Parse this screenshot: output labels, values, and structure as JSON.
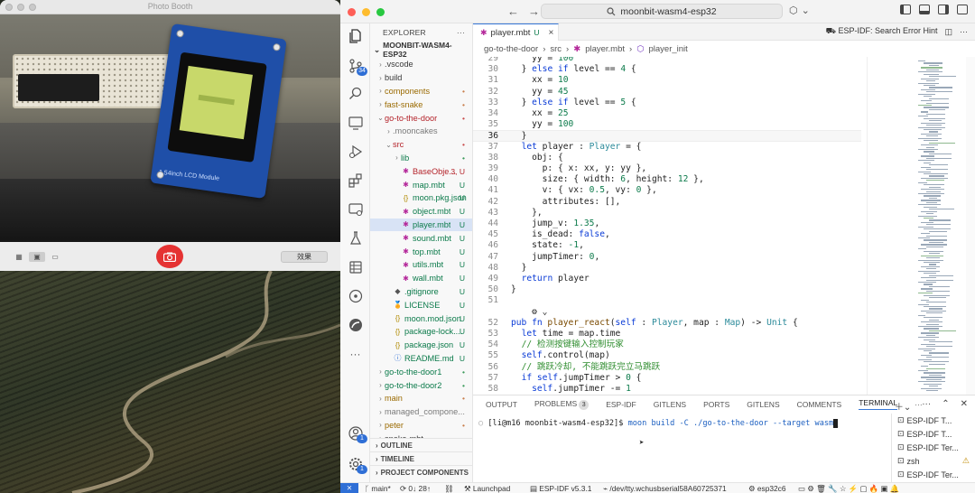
{
  "photobooth": {
    "title": "Photo Booth",
    "lcd_label": "1.54inch LCD Module",
    "effects_label": "效果"
  },
  "vscode": {
    "search_text": "moonbit-wasm4-esp32",
    "explorer_title": "EXPLORER",
    "root_folder": "MOONBIT-WASM4-ESP32",
    "tree": [
      {
        "name": ".vscode",
        "indent": 1,
        "chev": ">",
        "icon": "",
        "status": "",
        "color": "#3a3a3a"
      },
      {
        "name": "build",
        "indent": 1,
        "chev": ">",
        "icon": "",
        "status": "",
        "color": "#3a3a3a"
      },
      {
        "name": "components",
        "indent": 1,
        "chev": ">",
        "icon": "",
        "status": "•",
        "color": "#9a6a00",
        "scolor": "#c87d4b"
      },
      {
        "name": "fast-snake",
        "indent": 1,
        "chev": ">",
        "icon": "",
        "status": "•",
        "color": "#9a6a00",
        "scolor": "#c87d4b"
      },
      {
        "name": "go-to-the-door",
        "indent": 1,
        "chev": "⌄",
        "icon": "",
        "status": "•",
        "color": "#b4232a",
        "scolor": "#c84a4a"
      },
      {
        "name": ".mooncakes",
        "indent": 2,
        "chev": ">",
        "icon": "",
        "status": "",
        "color": "#7a7a7a"
      },
      {
        "name": "src",
        "indent": 2,
        "chev": "⌄",
        "icon": "",
        "status": "•",
        "color": "#b4232a",
        "scolor": "#c84a4a"
      },
      {
        "name": "lib",
        "indent": 3,
        "chev": ">",
        "icon": "",
        "status": "•",
        "color": "#0b7a4a",
        "scolor": "#3a9a5a"
      },
      {
        "name": "BaseObje...",
        "indent": 3,
        "chev": "",
        "icon": "✱",
        "status": "3, U",
        "color": "#b4232a",
        "scolor": "#b4232a",
        "icolor": "#b4289a"
      },
      {
        "name": "map.mbt",
        "indent": 3,
        "chev": "",
        "icon": "✱",
        "status": "U",
        "color": "#0b7a4a",
        "scolor": "#0b7a4a",
        "icolor": "#b4289a"
      },
      {
        "name": "moon.pkg.json",
        "indent": 3,
        "chev": "",
        "icon": "{}",
        "status": "U",
        "color": "#0b7a4a",
        "scolor": "#0b7a4a",
        "icolor": "#b08a00"
      },
      {
        "name": "object.mbt",
        "indent": 3,
        "chev": "",
        "icon": "✱",
        "status": "U",
        "color": "#0b7a4a",
        "scolor": "#0b7a4a",
        "icolor": "#b4289a"
      },
      {
        "name": "player.mbt",
        "indent": 3,
        "chev": "",
        "icon": "✱",
        "status": "U",
        "color": "#0b7a4a",
        "scolor": "#0b7a4a",
        "icolor": "#b4289a",
        "selected": true
      },
      {
        "name": "sound.mbt",
        "indent": 3,
        "chev": "",
        "icon": "✱",
        "status": "U",
        "color": "#0b7a4a",
        "scolor": "#0b7a4a",
        "icolor": "#b4289a"
      },
      {
        "name": "top.mbt",
        "indent": 3,
        "chev": "",
        "icon": "✱",
        "status": "U",
        "color": "#0b7a4a",
        "scolor": "#0b7a4a",
        "icolor": "#b4289a"
      },
      {
        "name": "utils.mbt",
        "indent": 3,
        "chev": "",
        "icon": "✱",
        "status": "U",
        "color": "#0b7a4a",
        "scolor": "#0b7a4a",
        "icolor": "#b4289a"
      },
      {
        "name": "wall.mbt",
        "indent": 3,
        "chev": "",
        "icon": "✱",
        "status": "U",
        "color": "#0b7a4a",
        "scolor": "#0b7a4a",
        "icolor": "#b4289a"
      },
      {
        "name": ".gitignore",
        "indent": 2,
        "chev": "",
        "icon": "◆",
        "status": "U",
        "color": "#0b7a4a",
        "scolor": "#0b7a4a",
        "icolor": "#555"
      },
      {
        "name": "LICENSE",
        "indent": 2,
        "chev": "",
        "icon": "🏅",
        "status": "U",
        "color": "#0b7a4a",
        "scolor": "#0b7a4a",
        "icolor": "#b08a00"
      },
      {
        "name": "moon.mod.json",
        "indent": 2,
        "chev": "",
        "icon": "{}",
        "status": "U",
        "color": "#0b7a4a",
        "scolor": "#0b7a4a",
        "icolor": "#b08a00"
      },
      {
        "name": "package-lock....",
        "indent": 2,
        "chev": "",
        "icon": "{}",
        "status": "U",
        "color": "#0b7a4a",
        "scolor": "#0b7a4a",
        "icolor": "#b08a00"
      },
      {
        "name": "package.json",
        "indent": 2,
        "chev": "",
        "icon": "{}",
        "status": "U",
        "color": "#0b7a4a",
        "scolor": "#0b7a4a",
        "icolor": "#b08a00"
      },
      {
        "name": "README.md",
        "indent": 2,
        "chev": "",
        "icon": "ⓘ",
        "status": "U",
        "color": "#0b7a4a",
        "scolor": "#0b7a4a",
        "icolor": "#2f6fd6"
      },
      {
        "name": "go-to-the-door1",
        "indent": 1,
        "chev": ">",
        "icon": "",
        "status": "•",
        "color": "#0b7a4a",
        "scolor": "#3a9a5a"
      },
      {
        "name": "go-to-the-door2",
        "indent": 1,
        "chev": ">",
        "icon": "",
        "status": "•",
        "color": "#0b7a4a",
        "scolor": "#3a9a5a"
      },
      {
        "name": "main",
        "indent": 1,
        "chev": ">",
        "icon": "",
        "status": "•",
        "color": "#9a6a00",
        "scolor": "#c87d4b"
      },
      {
        "name": "managed_compone...",
        "indent": 1,
        "chev": ">",
        "icon": "",
        "status": "",
        "color": "#7a7a7a"
      },
      {
        "name": "peter",
        "indent": 1,
        "chev": ">",
        "icon": "",
        "status": "•",
        "color": "#9a6a00",
        "scolor": "#c87d4b"
      },
      {
        "name": "snake-mbt",
        "indent": 1,
        "chev": ">",
        "icon": "",
        "status": "",
        "color": "#3a3a3a"
      }
    ],
    "sections": [
      "OUTLINE",
      "TIMELINE",
      "PROJECT COMPONENTS"
    ],
    "activity_badges": {
      "scm": "34",
      "accounts": "1",
      "manage": "1"
    },
    "tab_title": "player.mbt",
    "tab_status": "U",
    "tab_right_label": "ESP-IDF: Search Error Hint",
    "breadcrumbs": [
      "go-to-the-door",
      "src",
      "player.mbt",
      "player_init"
    ],
    "code_lines": [
      {
        "n": "29",
        "html": "    <span class=p>yy = </span><span class=n>100</span>"
      },
      {
        "n": "30",
        "html": "  <span class=p>} </span><span class=k>else if</span><span class=p> level == </span><span class=n>4</span><span class=p> {</span>"
      },
      {
        "n": "31",
        "html": "    <span class=p>xx = </span><span class=n>10</span>"
      },
      {
        "n": "32",
        "html": "    <span class=p>yy = </span><span class=n>45</span>"
      },
      {
        "n": "33",
        "html": "  <span class=p>} </span><span class=k>else if</span><span class=p> level == </span><span class=n>5</span><span class=p> {</span>"
      },
      {
        "n": "34",
        "html": "    <span class=p>xx = </span><span class=n>25</span>"
      },
      {
        "n": "35",
        "html": "    <span class=p>yy = </span><span class=n>100</span>"
      },
      {
        "n": "36",
        "html": "  <span class=p>}</span>",
        "current": true
      },
      {
        "n": "37",
        "html": "  <span class=k>let</span><span class=p> player : </span><span class=t>Player</span><span class=p> = {</span>"
      },
      {
        "n": "38",
        "html": "    <span class=p>obj: {</span>"
      },
      {
        "n": "39",
        "html": "      <span class=p>p: { x: xx, y: yy },</span>"
      },
      {
        "n": "40",
        "html": "      <span class=p>size: { width: </span><span class=n>6</span><span class=p>, height: </span><span class=n>12</span><span class=p> },</span>"
      },
      {
        "n": "41",
        "html": "      <span class=p>v: { vx: </span><span class=n>0.5</span><span class=p>, vy: </span><span class=n>0</span><span class=p> },</span>"
      },
      {
        "n": "42",
        "html": "      <span class=p>attributes: [],</span>"
      },
      {
        "n": "43",
        "html": "    <span class=p>},</span>"
      },
      {
        "n": "44",
        "html": "    <span class=p>jump_v: </span><span class=n>1.35</span><span class=p>,</span>"
      },
      {
        "n": "45",
        "html": "    <span class=p>is_dead: </span><span class=k>false</span><span class=p>,</span>"
      },
      {
        "n": "46",
        "html": "    <span class=p>state: </span><span class=n>-1</span><span class=p>,</span>"
      },
      {
        "n": "47",
        "html": "    <span class=p>jumpTimer: </span><span class=n>0</span><span class=p>,</span>"
      },
      {
        "n": "48",
        "html": "  <span class=p>}</span>"
      },
      {
        "n": "49",
        "html": "  <span class=k>return</span><span class=p> player</span>"
      },
      {
        "n": "50",
        "html": "<span class=p>}</span>"
      },
      {
        "n": "51",
        "html": ""
      },
      {
        "n": "",
        "html": "<span class=p>    ⚙ ⌄</span>"
      },
      {
        "n": "52",
        "html": "<span class=k>pub fn</span><span class=f> player_react</span><span class=p>(</span><span class=k>self</span><span class=p> : </span><span class=t>Player</span><span class=p>, map : </span><span class=t>Map</span><span class=p>) -&gt; </span><span class=t>Unit</span><span class=p> {</span>"
      },
      {
        "n": "53",
        "html": "  <span class=k>let</span><span class=p> time = map.time</span>"
      },
      {
        "n": "54",
        "html": "  <span class=c>// 检测按键输入控制玩家</span>"
      },
      {
        "n": "55",
        "html": "  <span class=k>self</span><span class=p>.control(map)</span>"
      },
      {
        "n": "56",
        "html": "  <span class=c>// 跳跃冷却, 不能跳跃完立马跳跃</span>"
      },
      {
        "n": "57",
        "html": "  <span class=k>if self</span><span class=p>.jumpTimer &gt; </span><span class=n>0</span><span class=p> {</span>"
      },
      {
        "n": "58",
        "html": "    <span class=k>self</span><span class=p>.jumpTimer -= </span><span class=n>1</span>"
      },
      {
        "n": "",
        "html": "  <span class=p>}</span>"
      }
    ],
    "panel_tabs": [
      "OUTPUT",
      "PROBLEMS",
      "ESP-IDF",
      "GITLENS",
      "PORTS",
      "GITLENS",
      "COMMENTS",
      "TERMINAL"
    ],
    "problems_count": "3",
    "terminal_prompt": "[li@m16 moonbit-wasm4-esp32]$ ",
    "terminal_cmd": "moon build -C ./go-to-the-door --target wasm",
    "terminals": [
      "ESP-IDF T...",
      "ESP-IDF T...",
      "ESP-IDF Ter...",
      "zsh",
      "ESP-IDF Ter..."
    ],
    "status": {
      "branch": "main*",
      "sync": "0↓ 28↑",
      "launchpad": "Launchpad",
      "idf": "ESP-IDF v5.3.1",
      "port": "/dev/tty.wchusbserial58A60725371",
      "chip": "esp32c6"
    }
  }
}
